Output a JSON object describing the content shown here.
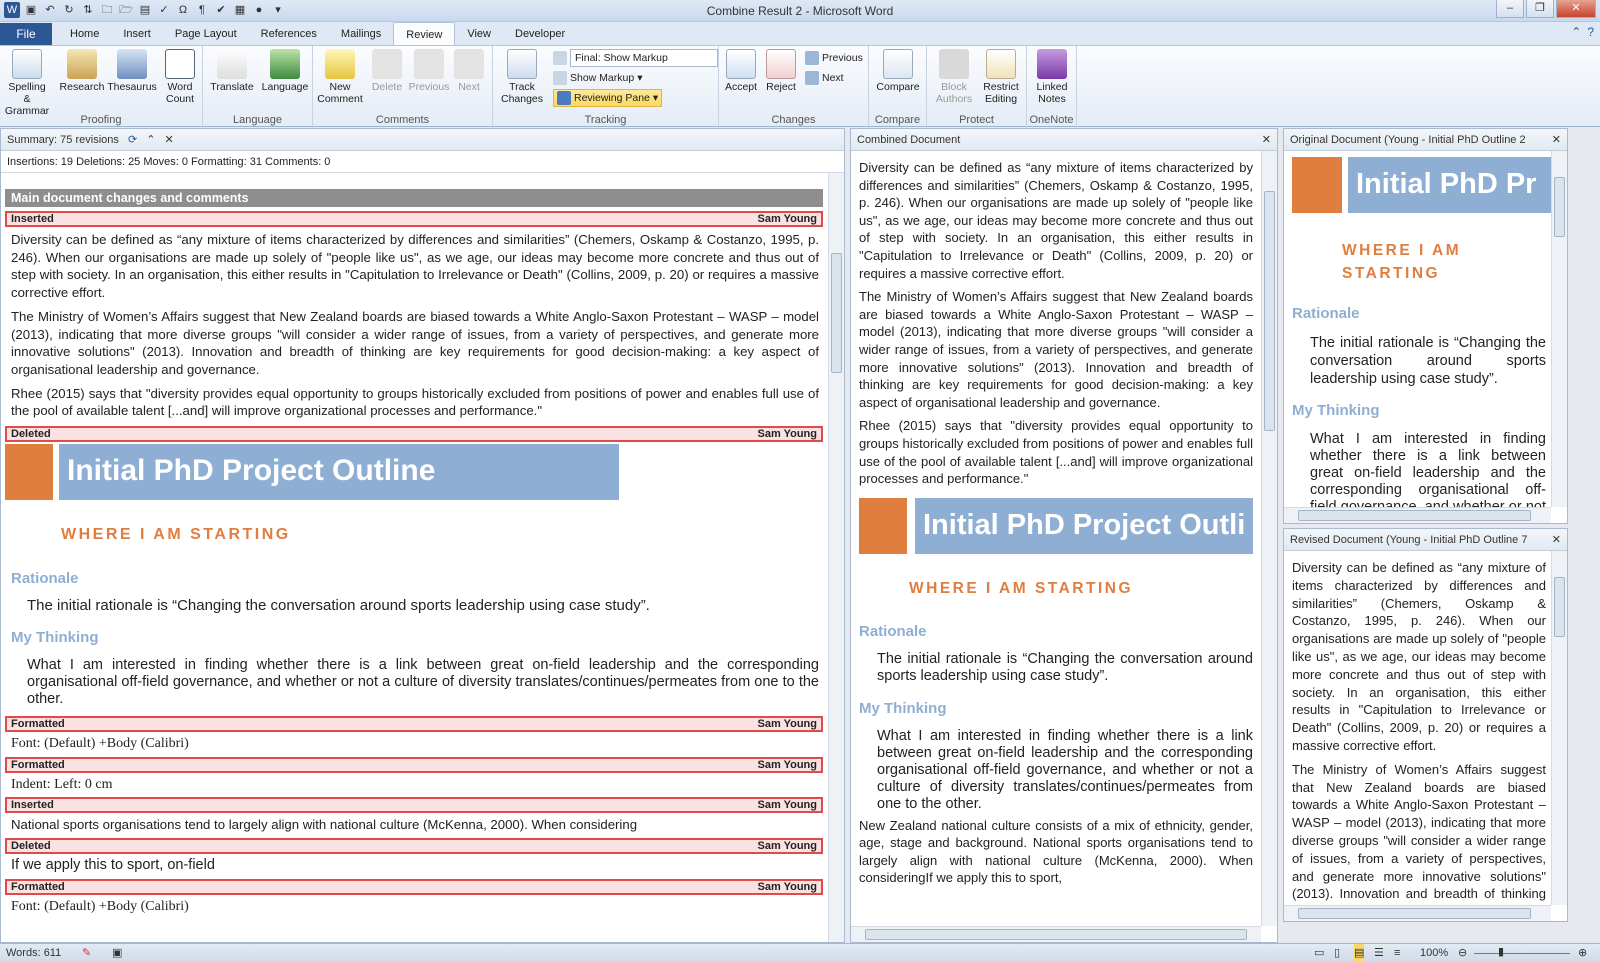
{
  "window": {
    "title": "Combine Result 2 - Microsoft Word"
  },
  "tabs": [
    "File",
    "Home",
    "Insert",
    "Page Layout",
    "References",
    "Mailings",
    "Review",
    "View",
    "Developer"
  ],
  "active_tab": "Review",
  "ribbon": {
    "proofing": {
      "label": "Proofing",
      "spelling": "Spelling & Grammar",
      "research": "Research",
      "thesaurus": "Thesaurus",
      "wordcount": "Word Count"
    },
    "language": {
      "label": "Language",
      "translate": "Translate",
      "language": "Language"
    },
    "comments": {
      "label": "Comments",
      "new": "New Comment",
      "delete": "Delete",
      "previous": "Previous",
      "next": "Next"
    },
    "tracking": {
      "label": "Tracking",
      "track": "Track Changes",
      "display": "Final: Show Markup",
      "showmarkup": "Show Markup",
      "pane": "Reviewing Pane"
    },
    "changes": {
      "label": "Changes",
      "accept": "Accept",
      "reject": "Reject",
      "previous": "Previous",
      "next": "Next"
    },
    "compare": {
      "label": "Compare",
      "compare": "Compare"
    },
    "protect": {
      "label": "Protect",
      "block": "Block Authors",
      "restrict": "Restrict Editing"
    },
    "onenote": {
      "label": "OneNote",
      "linked": "Linked Notes"
    }
  },
  "review_pane": {
    "summary": "Summary: 75 revisions",
    "counts": "Insertions: 19  Deletions: 25  Moves: 0  Formatting: 31  Comments: 0",
    "section": "Main document changes and comments",
    "author": "Sam Young",
    "types": {
      "inserted": "Inserted",
      "deleted": "Deleted",
      "formatted": "Formatted"
    },
    "p1": "Diversity can be defined as “any mixture of items characterized by differences and similarities” (Chemers, Oskamp & Costanzo, 1995, p. 246). When our organisations are made up solely of \"people like us\", as we age, our ideas may become more concrete and thus out of step with society. In an organisation, this either results in \"Capitulation to Irrelevance or Death\" (Collins, 2009, p. 20) or requires a massive corrective effort.",
    "p2": "The Ministry of Women’s Affairs suggest that New Zealand boards are biased towards a White Anglo-Saxon Protestant – WASP – model (2013), indicating that more diverse groups \"will consider a wider range of issues, from a variety of perspectives, and generate more innovative solutions\" (2013). Innovation and breadth of thinking are key requirements for good decision-making: a key aspect of organisational leadership and governance.",
    "p3": "Rhee (2015) says that \"diversity provides equal opportunity to groups historically excluded from positions of power and enables full use of the pool of available talent [...and] will improve organizational processes and performance.\"",
    "banner": "Initial PhD Project Outline",
    "subhead": "WHERE I AM STARTING",
    "rationale_h": "Rationale",
    "rationale": "The initial rationale is “Changing the conversation around sports leadership using case study”.",
    "thinking_h": "My Thinking",
    "thinking": "What I am interested in finding whether there is a link between great on-field leadership and the corresponding organisational off-field governance, and whether or not a culture of diversity translates/continues/permeates from one to the other.",
    "fmt1": "Font: (Default) +Body (Calibri)",
    "fmt2": "Indent: Left:  0 cm",
    "ins2": "National sports organisations tend to largely align with national culture (McKenna, 2000). When considering",
    "del2": "If we apply this to sport, on-field",
    "fmt3": "Font: (Default) +Body (Calibri)"
  },
  "combined": {
    "title": "Combined Document",
    "nz": "New Zealand national culture consists of a mix of ethnicity, gender, age, stage and background. National sports organisations tend to largely align with national culture (McKenna, 2000). When consideringIf we apply this to sport,"
  },
  "original": {
    "title": "Original Document (Young - Initial PhD Outline 2",
    "banner": "Initial PhD Pr"
  },
  "revised": {
    "title": "Revised Document (Young - Initial PhD Outline 7"
  },
  "combined_banner": "Initial PhD Project Outli",
  "status": {
    "words": "Words: 611",
    "zoom": "100%"
  }
}
